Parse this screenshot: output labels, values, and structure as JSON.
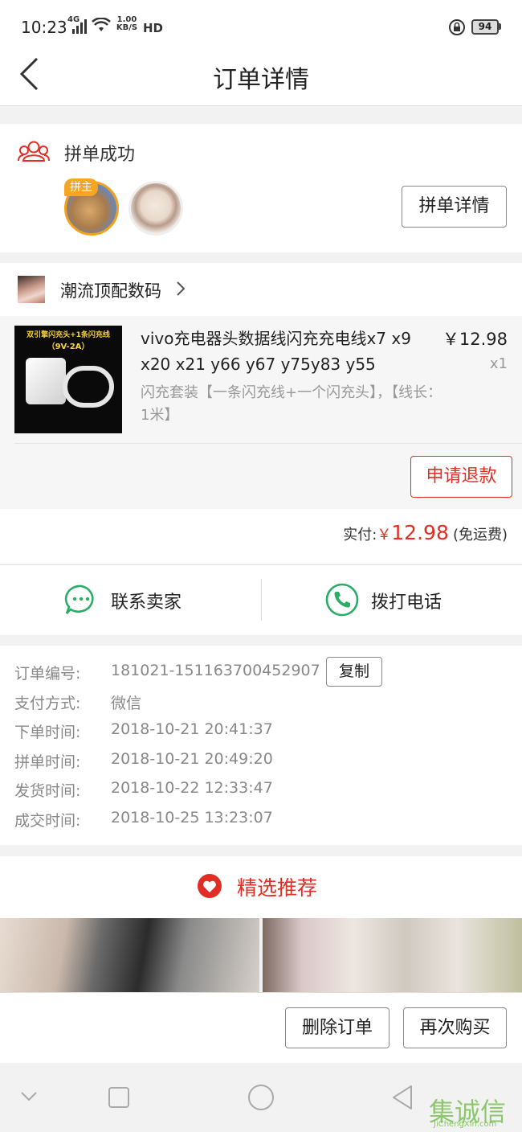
{
  "status_bar": {
    "time": "10:23",
    "signal": "4G",
    "net_speed_value": "1.00",
    "net_speed_unit": "KB/S",
    "hd": "HD",
    "battery": "94"
  },
  "header": {
    "title": "订单详情"
  },
  "group": {
    "status": "拼单成功",
    "leader_badge": "拼主",
    "details_button": "拼单详情"
  },
  "store": {
    "name": "潮流顶配数码"
  },
  "product": {
    "image_line1": "双引擎闪充头+1条闪充线",
    "image_line2": "（9V-2A）",
    "title": "vivo充电器头数据线闪充充电线x7 x9 x20 x21 y66 y67 y75y83 y55",
    "price": "￥12.98",
    "quantity": "x1",
    "spec": "闪充套装【一条闪充线+一个闪充头】，【线长：1米】",
    "refund_button": "申请退款"
  },
  "payment": {
    "label": "实付:",
    "currency": "￥",
    "amount": "12.98",
    "note": "(免运费)"
  },
  "contact": {
    "seller_label": "联系卖家",
    "call_label": "拨打电话"
  },
  "order_info": {
    "copy_button": "复制",
    "rows": [
      {
        "label": "订单编号:",
        "value": "181021-151163700452907"
      },
      {
        "label": "支付方式:",
        "value": "微信"
      },
      {
        "label": "下单时间:",
        "value": "2018-10-21 20:41:37"
      },
      {
        "label": "拼单时间:",
        "value": "2018-10-21 20:49:20"
      },
      {
        "label": "发货时间:",
        "value": "2018-10-22 12:33:47"
      },
      {
        "label": "成交时间:",
        "value": "2018-10-25 13:23:07"
      }
    ]
  },
  "recommend": {
    "title": "精选推荐"
  },
  "actions": {
    "delete_button": "删除订单",
    "rebuy_button": "再次购买"
  },
  "watermark": {
    "main": "集诚信",
    "sub": "JiChengXin.com"
  },
  "colors": {
    "accent_red": "#e02e24",
    "wechat_green": "#2aae67",
    "gray_text": "#888888"
  }
}
